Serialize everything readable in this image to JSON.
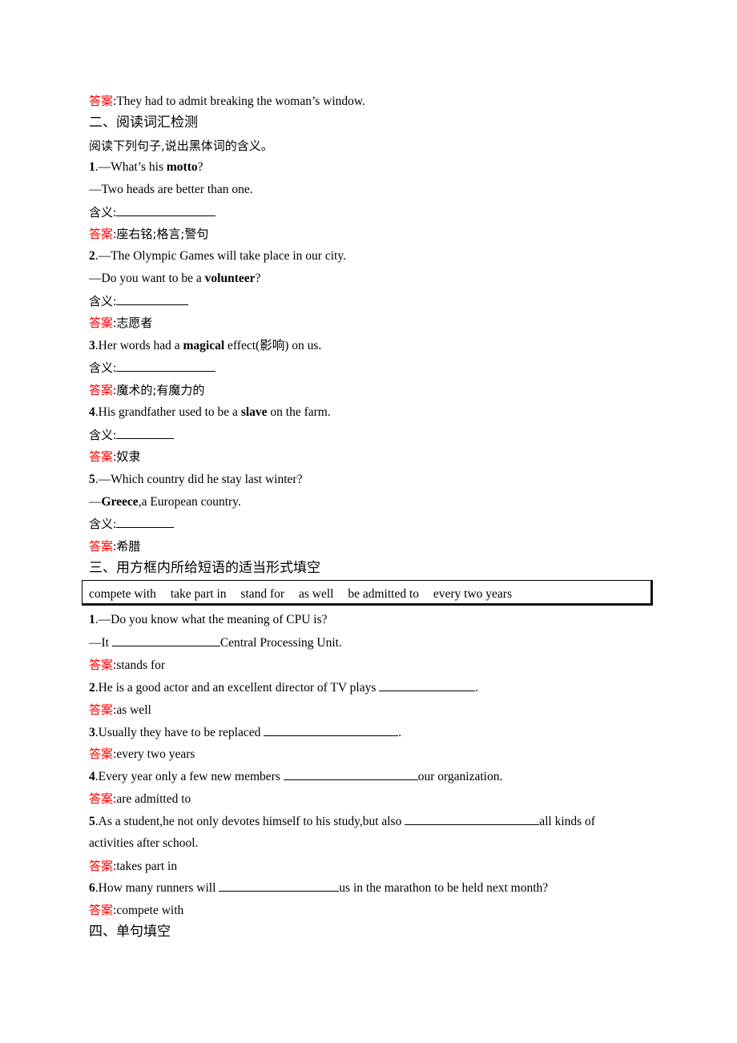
{
  "answer_label": "答案",
  "meaning_label": "含义",
  "intro_answer": "They had to admit breaking the woman’s window.",
  "section2": {
    "title": "二、阅读词汇检测",
    "instruction": "阅读下列句子,说出黑体词的含义。",
    "items": [
      {
        "num": "1",
        "pre": ".—What’s his ",
        "bold": "motto",
        "post": "?",
        "line2": "—Two heads are better than one.",
        "answer": "座右铭;格言;警句"
      },
      {
        "num": "2",
        "pre": ".—The Olympic Games will take place in our city.",
        "line2_pre": "—Do you want to be a ",
        "line2_bold": "volunteer",
        "line2_post": "?",
        "answer": "志愿者"
      },
      {
        "num": "3",
        "pre": ".Her words had a ",
        "bold": "magical",
        "post": " effect(影响) on us.",
        "answer": "魔术的;有魔力的"
      },
      {
        "num": "4",
        "pre": ".His grandfather used to be a ",
        "bold": "slave",
        "post": " on the farm.",
        "answer": "奴隶"
      },
      {
        "num": "5",
        "pre": ".—Which country did he stay last winter?",
        "line2_pre": "—",
        "line2_bold": "Greece",
        "line2_post": ",a European country.",
        "answer": "希腊"
      }
    ]
  },
  "section3": {
    "title": "三、用方框内所给短语的适当形式填空",
    "phrases": [
      "compete with",
      "take part in",
      "stand for",
      "as well",
      "be admitted to",
      "every two years"
    ],
    "items": [
      {
        "num": "1",
        "line1": ".—Do you know what the meaning of CPU is?",
        "line2_pre": "—It ",
        "line2_post": "Central Processing Unit.",
        "answer": "stands for"
      },
      {
        "num": "2",
        "pre": ".He is a good actor and an excellent director of TV plays ",
        "post": ".",
        "answer": "as well"
      },
      {
        "num": "3",
        "pre": ".Usually they have to be replaced ",
        "post": ".",
        "answer": "every two years"
      },
      {
        "num": "4",
        "pre": ".Every year only a few new members ",
        "post": "our organization.",
        "answer": "are admitted to"
      },
      {
        "num": "5",
        "pre": ".As a student,he not only devotes himself to his study,but also ",
        "post": "all kinds of",
        "line2": "activities after school.",
        "answer": "takes part in"
      },
      {
        "num": "6",
        "pre": ".How many runners will ",
        "post": "us in the marathon to be held next month?",
        "answer": "compete with"
      }
    ]
  },
  "section4": {
    "title": "四、单句填空"
  }
}
